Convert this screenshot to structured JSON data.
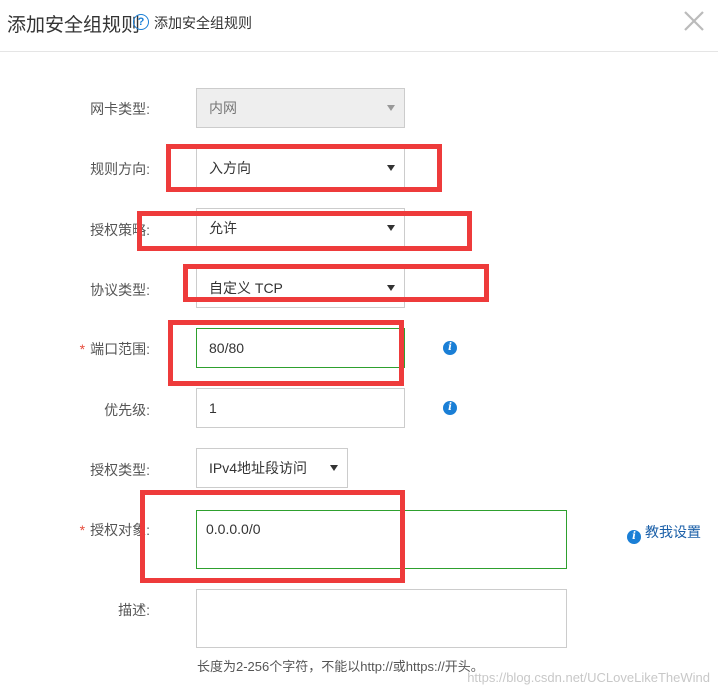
{
  "header": {
    "title": "添加安全组规则",
    "help_text": "添加安全组规则"
  },
  "form": {
    "nic_type": {
      "label": "网卡类型:",
      "value": "内网"
    },
    "direction": {
      "label": "规则方向:",
      "value": "入方向"
    },
    "policy": {
      "label": "授权策略:",
      "value": "允许"
    },
    "protocol": {
      "label": "协议类型:",
      "value": "自定义 TCP"
    },
    "port_range": {
      "label": "端口范围:",
      "required_mark": "*",
      "value": "80/80"
    },
    "priority": {
      "label": "优先级:",
      "value": "1"
    },
    "auth_type": {
      "label": "授权类型:",
      "value": "IPv4地址段访问"
    },
    "auth_object": {
      "label": "授权对象:",
      "required_mark": "*",
      "value": "0.0.0.0/0",
      "help_link": "教我设置"
    },
    "description": {
      "label": "描述:",
      "value": "",
      "hint": "长度为2-256个字符，不能以http://或https://开头。"
    }
  },
  "watermark": "https://blog.csdn.net/UCLoveLikeTheWind",
  "colors": {
    "highlight_box": "#ee3b3b",
    "valid_border": "#2ea02e",
    "info_blue": "#1a7fd6",
    "required_star": "#e74c3c"
  }
}
